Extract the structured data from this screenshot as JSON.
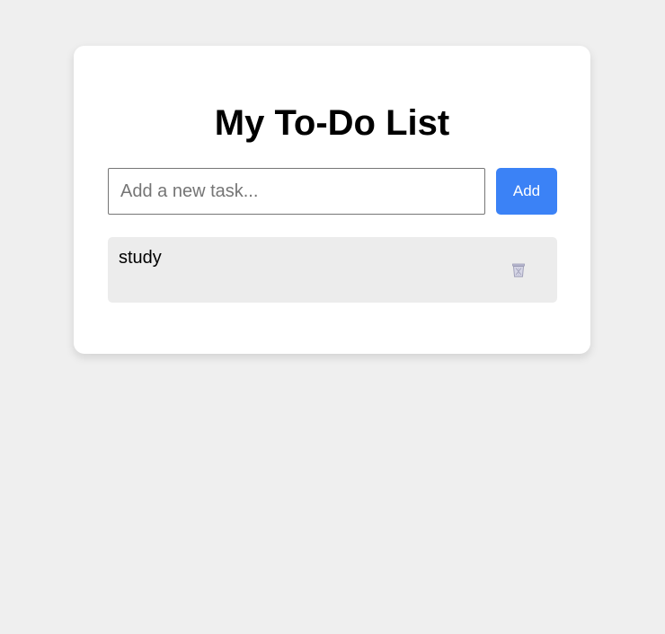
{
  "app": {
    "title": "My To-Do List"
  },
  "new_task": {
    "value": "",
    "placeholder": "Add a new task...",
    "add_label": "Add"
  },
  "tasks": [
    {
      "text": "study",
      "delete_icon": "trash-icon"
    }
  ],
  "colors": {
    "page_background": "#efefef",
    "card_background": "#ffffff",
    "accent": "#3b82f6",
    "task_background": "#ececec"
  }
}
